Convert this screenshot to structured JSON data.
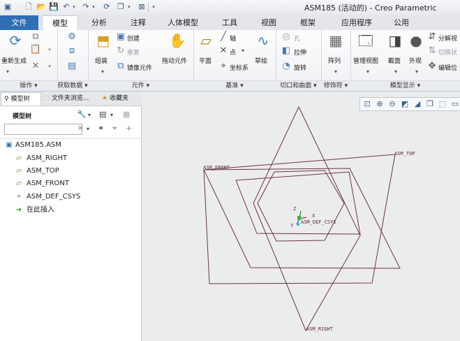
{
  "window": {
    "title": "ASM185 (活动的) - Creo Parametric"
  },
  "tabs": {
    "file": "文件",
    "items": [
      "模型",
      "分析",
      "注释",
      "人体模型",
      "工具",
      "视图",
      "框架",
      "应用程序",
      "公用"
    ]
  },
  "ribbon": {
    "ops": {
      "regen": "重新生成",
      "label": "操作"
    },
    "getdata": {
      "label": "获取数据"
    },
    "component": {
      "assemble": "组装",
      "create": "创建",
      "repeat": "重复",
      "mirror": "镜像元件",
      "drag": "拖动元件",
      "label": "元件"
    },
    "datum": {
      "plane": "平面",
      "axis": "轴",
      "point": "点",
      "csys": "坐标系",
      "sketch": "草绘",
      "label": "基准"
    },
    "cut": {
      "hole": "孔",
      "extrude": "拉伸",
      "revolve": "旋转",
      "label": "切口和曲面"
    },
    "modifiers": {
      "pattern": "阵列",
      "label": "修饰符"
    },
    "display": {
      "manage": "管理视图",
      "section": "截面",
      "appearance": "外观",
      "explode": "分解视",
      "toggle_explode": "切换状",
      "edit_pos": "编辑位",
      "label": "模型显示"
    }
  },
  "panel": {
    "tabs": [
      "模型树",
      "文件夹浏览...",
      "收藏夹"
    ],
    "tree_title": "模型树",
    "search": {
      "value": "",
      "placeholder": ""
    },
    "nodes": [
      {
        "label": "ASM185.ASM",
        "icon": "assembly-icon"
      },
      {
        "label": "ASM_RIGHT",
        "icon": "datum-plane-icon"
      },
      {
        "label": "ASM_TOP",
        "icon": "datum-plane-icon"
      },
      {
        "label": "ASM_FRONT",
        "icon": "datum-plane-icon"
      },
      {
        "label": "ASM_DEF_CSYS",
        "icon": "csys-icon"
      },
      {
        "label": "在此插入",
        "icon": "insert-here-icon"
      }
    ]
  },
  "graphics": {
    "planes": {
      "front": "ASM_FRONT",
      "top": "ASM_TOP",
      "right": "ASM_RIGHT"
    },
    "csys": {
      "label": "ASM_DEF_CSYS",
      "z": "Z",
      "x": "X",
      "y": "Y"
    },
    "line_color": "#6b3540"
  },
  "colors": {
    "accent": "#2f6fb3"
  }
}
